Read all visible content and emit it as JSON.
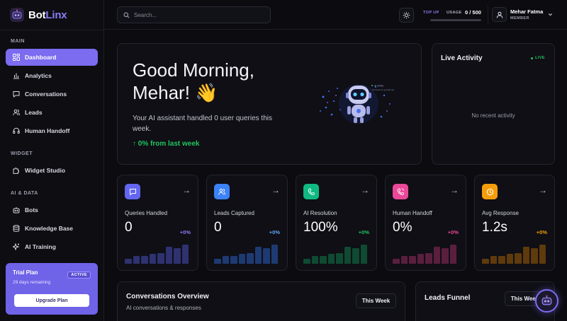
{
  "brand": {
    "name_part1": "Bot",
    "name_part2": "Linx",
    "accent": "#8b7cf6"
  },
  "sidebar": {
    "sections": [
      {
        "label": "MAIN"
      },
      {
        "label": "WIDGET"
      },
      {
        "label": "AI & DATA"
      }
    ],
    "items": [
      {
        "label": "Dashboard",
        "icon": "dashboard-icon",
        "active": true
      },
      {
        "label": "Analytics",
        "icon": "bar-chart-icon"
      },
      {
        "label": "Conversations",
        "icon": "chat-icon"
      },
      {
        "label": "Leads",
        "icon": "users-icon"
      },
      {
        "label": "Human Handoff",
        "icon": "headset-icon"
      },
      {
        "label": "Widget Studio",
        "icon": "puzzle-icon"
      },
      {
        "label": "Bots",
        "icon": "bot-icon"
      },
      {
        "label": "Knowledge Base",
        "icon": "database-icon"
      },
      {
        "label": "AI Training",
        "icon": "sparkle-icon"
      }
    ],
    "trial": {
      "title": "Trial Plan",
      "badge": "ACTIVE",
      "remaining": "29 days remaining",
      "button": "Upgrade Plan"
    }
  },
  "header": {
    "search_placeholder": "Search...",
    "topup": "TOP UP",
    "usage_label": "USAGE",
    "usage_value": "0 / 500",
    "usage_fraction": 0.0,
    "user_name": "Mehar Fatma",
    "user_role": "MEMBER"
  },
  "hero": {
    "greeting_line1": "Good Morning,",
    "greeting_line2": "Mehar! 👋",
    "subtitle": "Your AI assistant handled 0 user queries this week.",
    "trend": "↑ 0% from last week"
  },
  "live_activity": {
    "title": "Live Activity",
    "badge": "LIVE",
    "empty": "No recent activity"
  },
  "stats": [
    {
      "label": "Queries Handled",
      "value": "0",
      "change": "+0%",
      "color": "#6366f1",
      "bar_color": "#2e3270",
      "change_color": "#8b7cf6",
      "icon": "message-icon",
      "bars": [
        0.25,
        0.4,
        0.4,
        0.5,
        0.55,
        0.85,
        0.8,
        0.95
      ]
    },
    {
      "label": "Leads Captured",
      "value": "0",
      "change": "+0%",
      "color": "#3b82f6",
      "bar_color": "#1e3a72",
      "change_color": "#60a5fa",
      "icon": "users-icon",
      "bars": [
        0.25,
        0.4,
        0.4,
        0.5,
        0.55,
        0.85,
        0.8,
        0.95
      ]
    },
    {
      "label": "AI Resolution",
      "value": "100%",
      "change": "+0%",
      "color": "#10b981",
      "bar_color": "#0f4a32",
      "change_color": "#22c55e",
      "icon": "phone-icon",
      "bars": [
        0.25,
        0.4,
        0.4,
        0.5,
        0.55,
        0.85,
        0.8,
        0.95
      ]
    },
    {
      "label": "Human Handoff",
      "value": "0%",
      "change": "+0%",
      "color": "#ec4899",
      "bar_color": "#5a1e3e",
      "change_color": "#ec4899",
      "icon": "phone-call-icon",
      "bars": [
        0.25,
        0.4,
        0.4,
        0.5,
        0.55,
        0.85,
        0.8,
        0.95
      ]
    },
    {
      "label": "Avg Response",
      "value": "1.2s",
      "change": "+0%",
      "color": "#f59e0b",
      "bar_color": "#5e3a0c",
      "change_color": "#f59e0b",
      "icon": "clock-icon",
      "bars": [
        0.25,
        0.4,
        0.4,
        0.5,
        0.55,
        0.85,
        0.8,
        0.95
      ]
    }
  ],
  "conversations": {
    "title": "Conversations Overview",
    "subtitle": "AI conversations & responses",
    "range": "This Week"
  },
  "funnel": {
    "title": "Leads Funnel",
    "range": "This Week"
  },
  "robot_labels": {
    "line1": "AI Online",
    "line2": "All systems operational"
  }
}
